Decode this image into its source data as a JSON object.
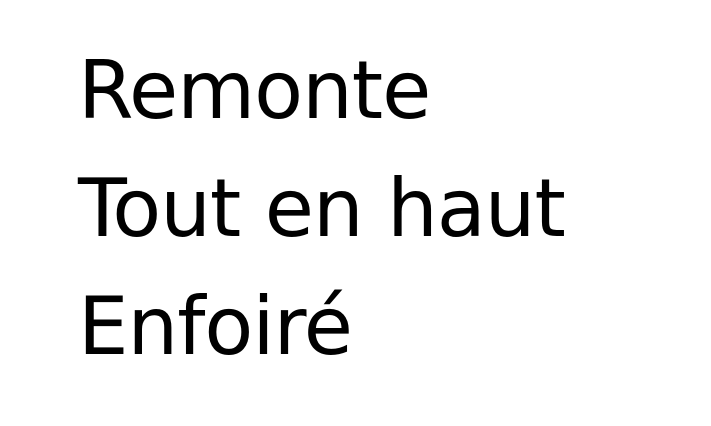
{
  "lines": [
    "Remonte",
    "Tout en haut",
    "Enfoiré"
  ],
  "colors": {
    "background": "#ffffff",
    "text": "#000000"
  }
}
